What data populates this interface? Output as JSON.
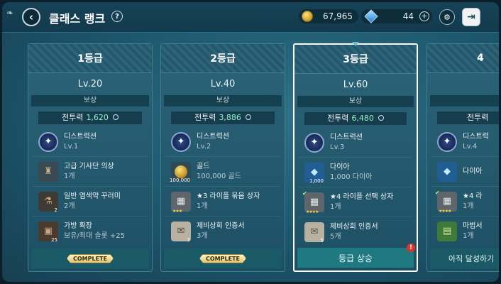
{
  "header": {
    "title": "클래스 랭크",
    "help": "?",
    "gold": "67,965",
    "gems": "44",
    "plus": "+"
  },
  "cards": [
    {
      "grade": "1등급",
      "level": "Lv.20",
      "reward_label": "보상",
      "power_label": "전투력",
      "power_value": "1,620",
      "rewards": [
        {
          "icon": "distruction-class-icon",
          "name": "디스트럭션",
          "sub": "Lv.1",
          "badge": ""
        },
        {
          "icon": "knight-costume-icon",
          "name": "고급 기사단 의상",
          "sub": "1개",
          "badge": ""
        },
        {
          "icon": "dye-icon",
          "name": "일반 염색약 꾸러미",
          "sub": "2개",
          "badge": "2"
        },
        {
          "icon": "bag-icon",
          "name": "가방 확장",
          "sub": "보유/최대 슬롯 +25",
          "badge": "25"
        }
      ],
      "footer": "COMPLETE"
    },
    {
      "grade": "2등급",
      "level": "Lv.40",
      "reward_label": "보상",
      "power_label": "전투력",
      "power_value": "3,886",
      "rewards": [
        {
          "icon": "distruction-class-icon",
          "name": "디스트럭션",
          "sub": "Lv.2",
          "badge": ""
        },
        {
          "icon": "gold-coin-icon",
          "name": "골드",
          "sub": "100,000 골드",
          "badge": "100,000"
        },
        {
          "icon": "chest-icon",
          "name": "★3 라이플 묶음 상자",
          "sub": "1개",
          "badge": "★★★"
        },
        {
          "icon": "certificate-icon",
          "name": "제비상회 인증서",
          "sub": "3개",
          "badge": "3"
        }
      ],
      "footer": "COMPLETE"
    },
    {
      "grade": "3등급",
      "level": "Lv.60",
      "reward_label": "보상",
      "power_label": "전투력",
      "power_value": "6,480",
      "rewards": [
        {
          "icon": "distruction-class-icon",
          "name": "디스트럭션",
          "sub": "Lv.3",
          "badge": ""
        },
        {
          "icon": "diamond-icon",
          "name": "다이아",
          "sub": "1,000 다이아",
          "badge": "1,000"
        },
        {
          "icon": "chest-icon",
          "name": "★4 라이플 선택 상자",
          "sub": "1개",
          "badge": "★★★★"
        },
        {
          "icon": "certificate-icon",
          "name": "제비상회 인증서",
          "sub": "5개",
          "badge": "5"
        }
      ],
      "footer": "등급 상승",
      "alert": "!"
    },
    {
      "grade": "4",
      "level": "",
      "reward_label": "",
      "power_label": "전투력",
      "power_value": "",
      "rewards": [
        {
          "icon": "distruction-class-icon",
          "name": "디스트럭",
          "sub": "Lv.4",
          "badge": ""
        },
        {
          "icon": "diamond-icon",
          "name": "다이아",
          "sub": "",
          "badge": ""
        },
        {
          "icon": "chest-icon",
          "name": "★4 라",
          "sub": "1개",
          "badge": "★★★★"
        },
        {
          "icon": "book-icon",
          "name": "마법서",
          "sub": "1개",
          "badge": ""
        }
      ],
      "footer": "아직 달성하기"
    }
  ]
}
